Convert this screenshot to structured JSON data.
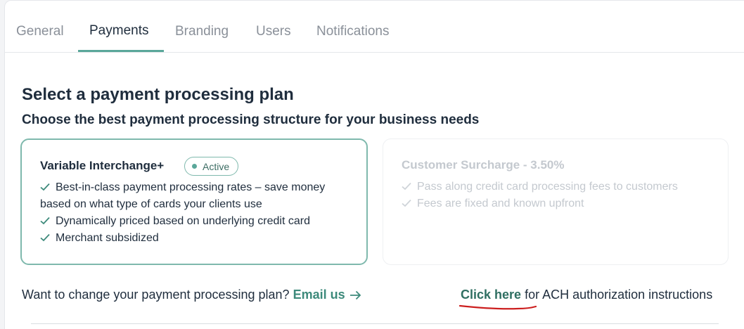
{
  "tabs": [
    {
      "label": "General",
      "active": false
    },
    {
      "label": "Payments",
      "active": true
    },
    {
      "label": "Branding",
      "active": false
    },
    {
      "label": "Users",
      "active": false
    },
    {
      "label": "Notifications",
      "active": false
    }
  ],
  "header": {
    "title": "Select a payment processing plan",
    "subtitle": "Choose the best payment processing structure for your business needs"
  },
  "plans": [
    {
      "name": "Variable Interchange+",
      "status_badge": "Active",
      "selected": true,
      "features": [
        "Best-in-class payment processing rates – save money based on what type of cards your clients use",
        "Dynamically priced based on underlying credit card",
        "Merchant subsidized"
      ]
    },
    {
      "name": "Customer Surcharge - 3.50%",
      "selected": false,
      "features": [
        "Pass along credit card processing fees to customers",
        "Fees are fixed and known upfront"
      ]
    }
  ],
  "footer": {
    "change_prompt": "Want to change your payment processing plan?",
    "email_link": "Email us",
    "ach_link": "Click here",
    "ach_text": "for ACH authorization instructions"
  },
  "colors": {
    "accent": "#5aa79a",
    "link": "#3d8a7b",
    "text": "#1f2d3d",
    "muted": "#8a9099",
    "disabled": "#c4c9cf",
    "annotation": "#cc1f1f"
  }
}
